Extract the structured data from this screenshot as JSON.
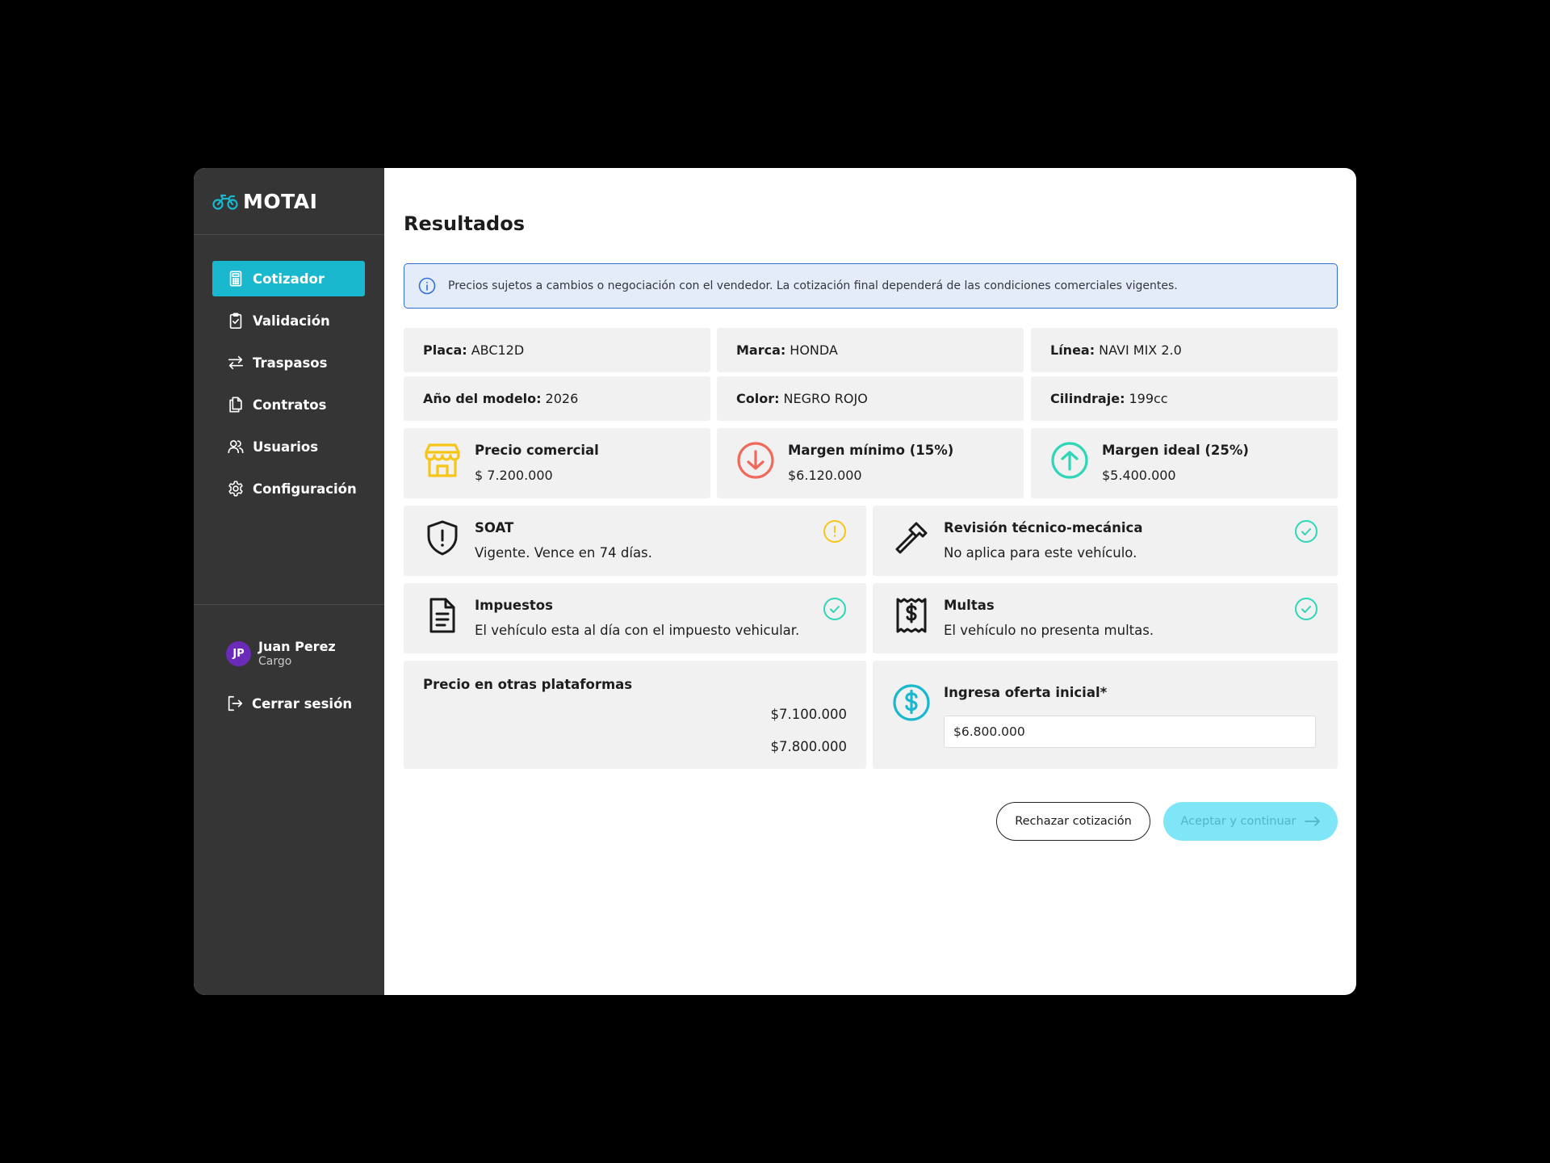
{
  "brand": {
    "name": "MOTAI",
    "icon": "motorcycle-icon"
  },
  "sidebar": {
    "items": [
      {
        "label": "Cotizador",
        "icon": "calculator-icon",
        "active": true
      },
      {
        "label": "Validación",
        "icon": "clipboard-check-icon"
      },
      {
        "label": "Traspasos",
        "icon": "arrows-swap-icon"
      },
      {
        "label": "Contratos",
        "icon": "documents-icon"
      },
      {
        "label": "Usuarios",
        "icon": "users-icon"
      },
      {
        "label": "Configuración",
        "icon": "gear-icon"
      }
    ],
    "user": {
      "initials": "JP",
      "name": "Juan Perez",
      "role": "Cargo",
      "avatar_color": "#6a2bb8"
    },
    "logout_label": "Cerrar sesión"
  },
  "main": {
    "title": "Resultados",
    "notice": "Precios sujetos a cambios o negociación con el vendedor. La cotización final dependerá de las condiciones comerciales vigentes.",
    "vehicle": {
      "placa": {
        "label": "Placa:",
        "value": "ABC12D"
      },
      "marca": {
        "label": "Marca:",
        "value": "HONDA"
      },
      "linea": {
        "label": "Línea:",
        "value": "NAVI MIX 2.0"
      },
      "anio": {
        "label": "Año del modelo:",
        "value": "2026"
      },
      "color": {
        "label": "Color:",
        "value": "NEGRO ROJO"
      },
      "cilindraje": {
        "label": "Cilindraje:",
        "value": "199cc"
      }
    },
    "metrics": {
      "comercial": {
        "title": "Precio comercial",
        "value": "$ 7.200.000",
        "icon": "store-icon",
        "color": "#f5c518"
      },
      "minimo": {
        "title": "Margen mínimo (15%)",
        "value": "$6.120.000",
        "icon": "arrow-down-circle-icon",
        "color": "#ef6a5c"
      },
      "ideal": {
        "title": "Margen ideal (25%)",
        "value": "$5.400.000",
        "icon": "arrow-up-circle-icon",
        "color": "#2fd6b8"
      }
    },
    "checks": {
      "soat": {
        "title": "SOAT",
        "desc": "Vigente. Vence en 74 días.",
        "status": "warning"
      },
      "revision": {
        "title": "Revisión técnico-mecánica",
        "desc": "No aplica para este vehículo.",
        "status": "ok"
      },
      "impuestos": {
        "title": "Impuestos",
        "desc": "El vehículo esta al día con el impuesto vehicular.",
        "status": "ok"
      },
      "multas": {
        "title": "Multas",
        "desc": "El vehículo no presenta multas.",
        "status": "ok"
      }
    },
    "platforms": {
      "title": "Precio en otras plataformas",
      "prices": [
        "$7.100.000",
        "$7.800.000"
      ]
    },
    "offer": {
      "label": "Ingresa oferta inicial*",
      "value": "$6.800.000"
    },
    "buttons": {
      "reject": "Rechazar cotización",
      "accept": "Aceptar y continuar"
    },
    "colors": {
      "accent": "#19b8cf",
      "sidebar": "#353535",
      "warning": "#f5c518",
      "ok": "#2fd6b8",
      "danger": "#ef6a5c"
    }
  }
}
